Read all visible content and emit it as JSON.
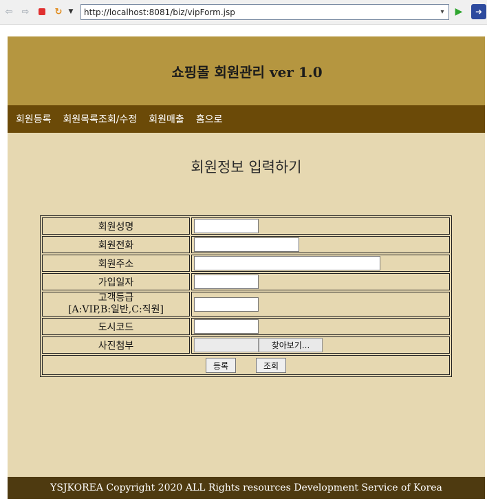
{
  "browser": {
    "url": "http://localhost:8081/biz/vipForm.jsp",
    "back_icon": "back-arrow-icon",
    "forward_icon": "forward-arrow-icon",
    "stop_icon": "stop-icon",
    "reload_icon": "reload-icon",
    "go_icon": "go-arrow-icon"
  },
  "header": {
    "title": "쇼핑몰 회원관리 ver 1.0"
  },
  "nav": {
    "items": [
      "회원등록",
      "회원목록조회/수정",
      "회원매출",
      "홈으로"
    ]
  },
  "main": {
    "heading": "회원정보 입력하기",
    "fields": {
      "name": {
        "label": "회원성명",
        "value": ""
      },
      "phone": {
        "label": "회원전화",
        "value": ""
      },
      "address": {
        "label": "회원주소",
        "value": ""
      },
      "join_date": {
        "label": "가입일자",
        "value": ""
      },
      "grade": {
        "label_line1": "고객등급",
        "label_line2": "[A:VIP,B:일반,C:직원]",
        "value": ""
      },
      "city": {
        "label": "도시코드",
        "value": ""
      },
      "photo": {
        "label": "사진첨부",
        "browse_label": "찾아보기..."
      }
    },
    "buttons": {
      "register": "등록",
      "search": "조회"
    }
  },
  "footer": {
    "text": "YSJKOREA Copyright 2020 ALL Rights resources Development Service of Korea"
  },
  "colors": {
    "header_bg": "#b59640",
    "nav_bg": "#6b4a08",
    "content_bg": "#e6d8b1",
    "footer_bg": "#4e3a10"
  }
}
